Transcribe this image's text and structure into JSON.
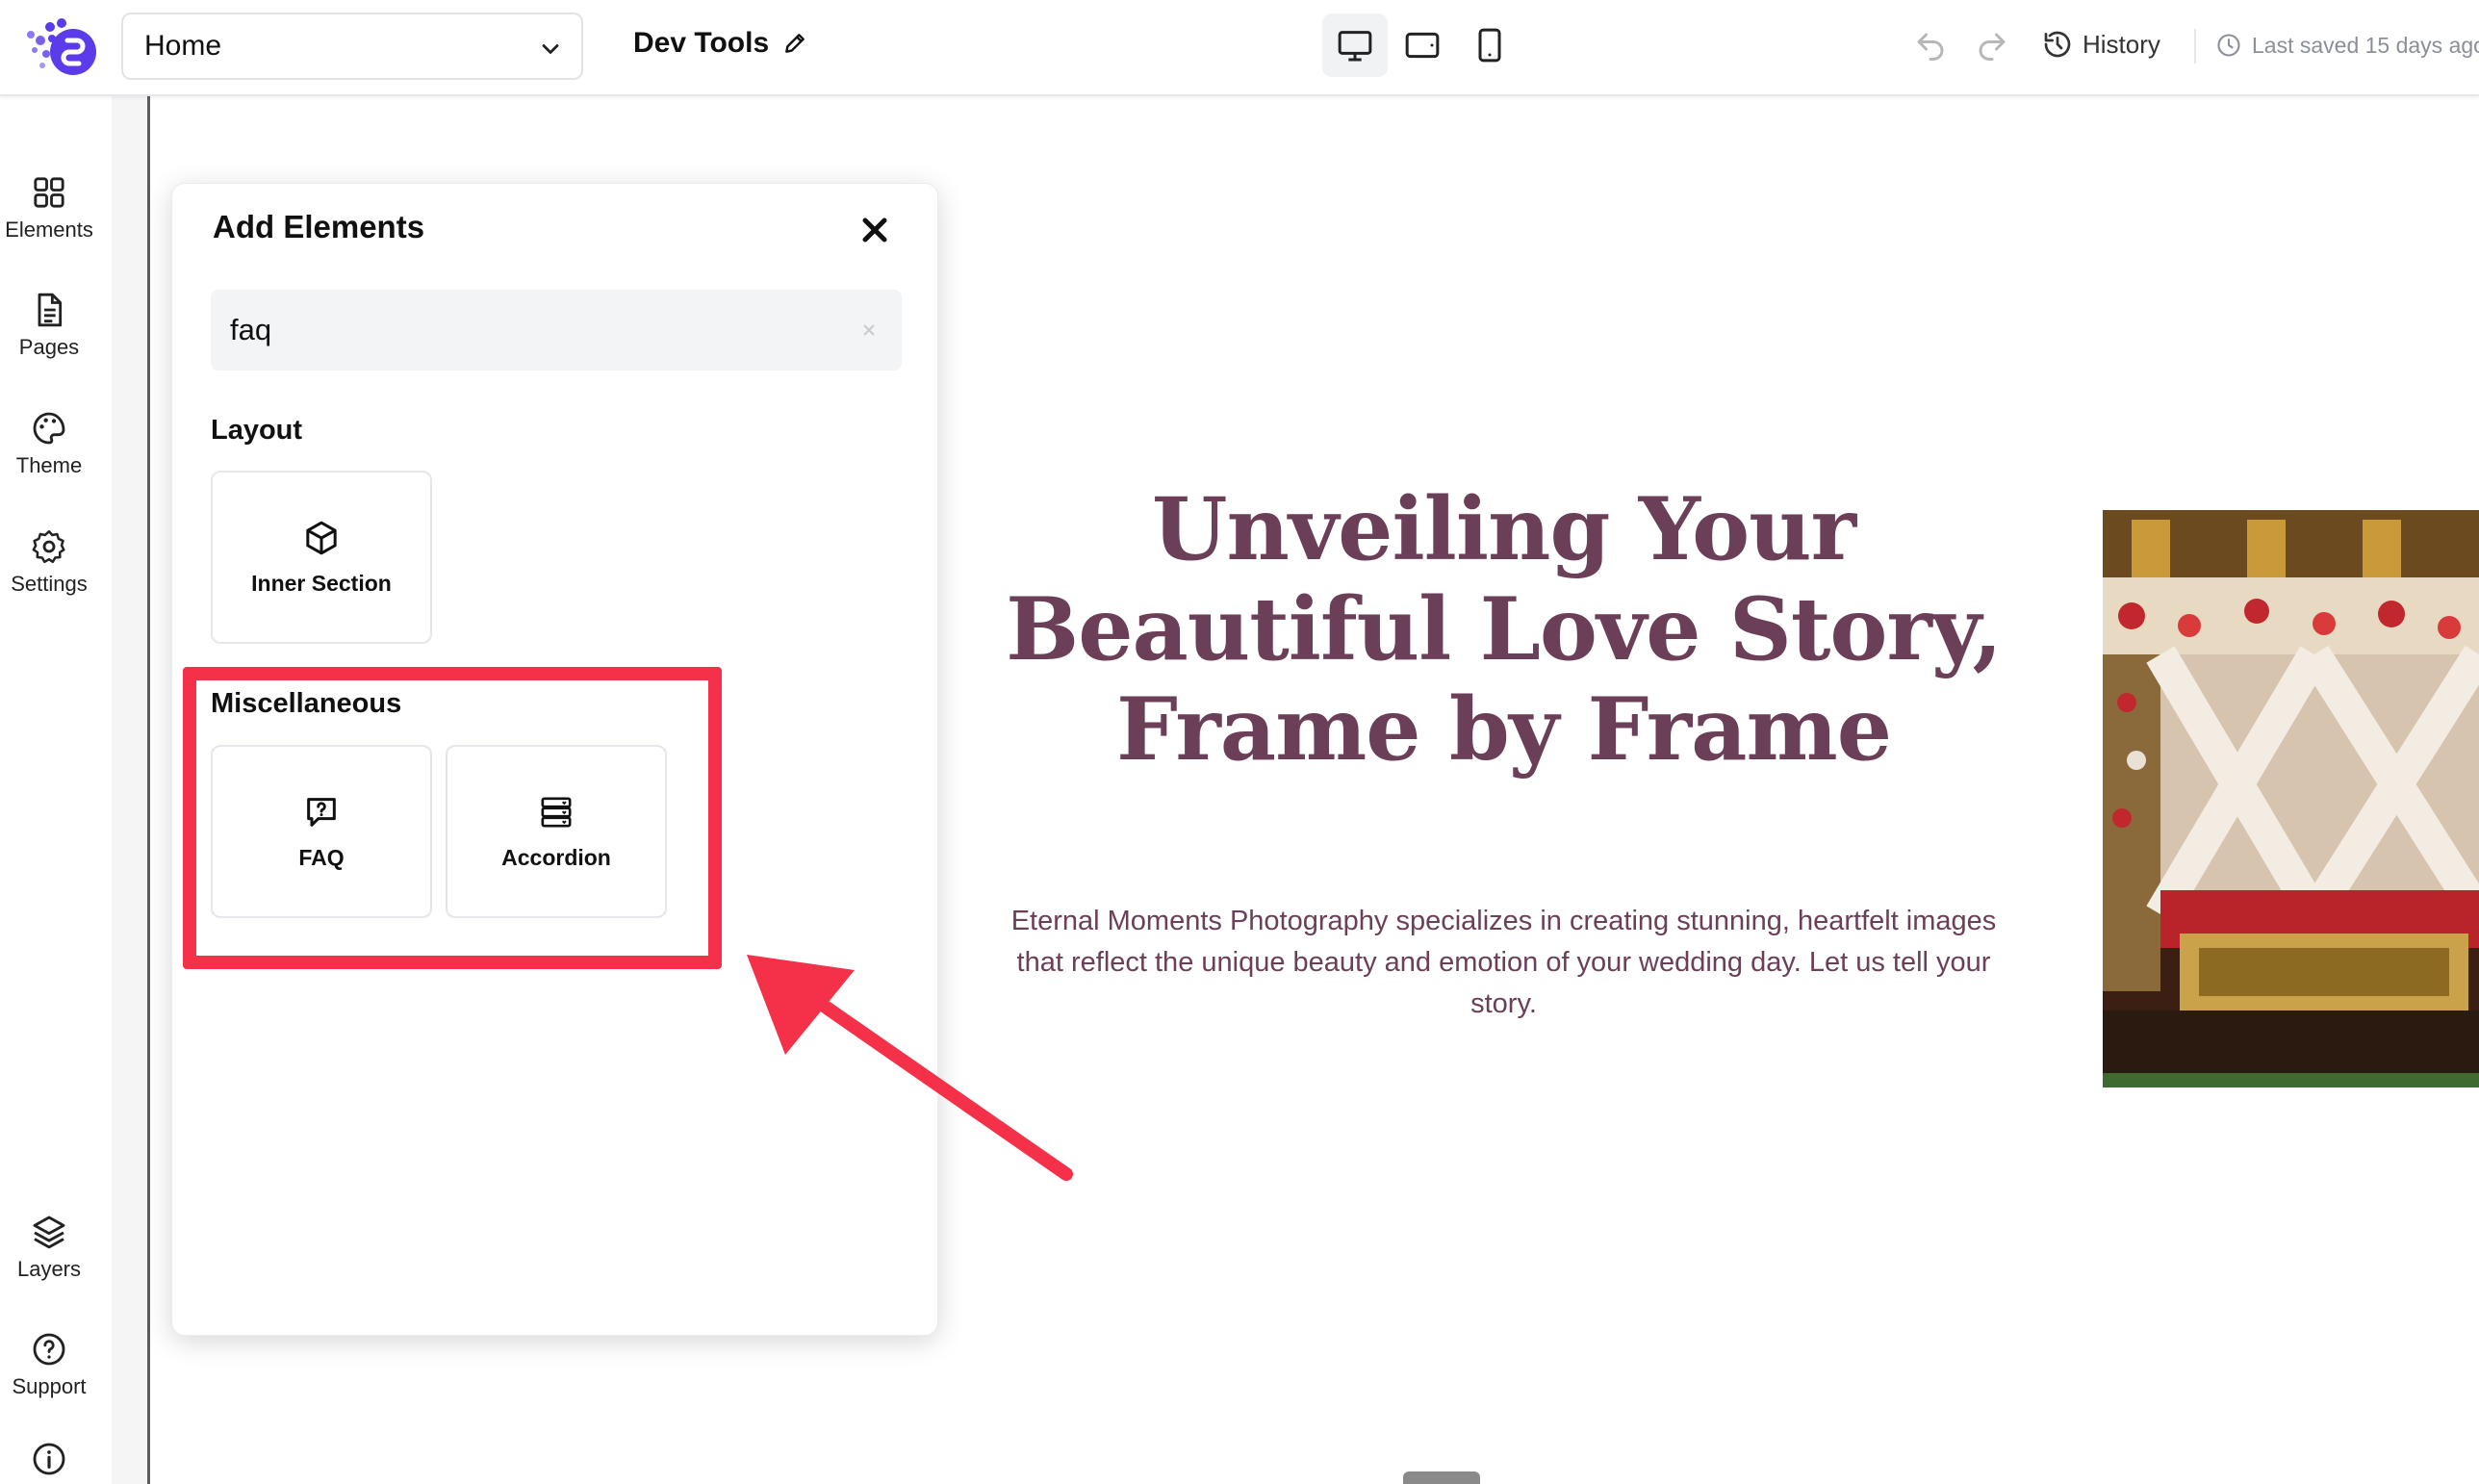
{
  "topbar": {
    "page_select_value": "Home",
    "site_name": "Dev Tools",
    "history_label": "History",
    "last_saved": "Last saved 15 days ago",
    "devices": [
      "desktop-icon",
      "tablet-icon",
      "mobile-icon"
    ],
    "active_device": "desktop"
  },
  "sidebar": {
    "items": [
      {
        "label": "Elements",
        "icon": "grid-icon"
      },
      {
        "label": "Pages",
        "icon": "document-icon"
      },
      {
        "label": "Theme",
        "icon": "palette-icon"
      },
      {
        "label": "Settings",
        "icon": "gear-icon"
      }
    ],
    "bottom_items": [
      {
        "label": "Layers",
        "icon": "layers-icon"
      },
      {
        "label": "Support",
        "icon": "help-icon"
      }
    ]
  },
  "panel": {
    "title": "Add Elements",
    "search_value": "faq",
    "sections": [
      {
        "label": "Layout",
        "tiles": [
          {
            "label": "Inner Section",
            "icon": "cube-icon"
          }
        ]
      },
      {
        "label": "Miscellaneous",
        "tiles": [
          {
            "label": "FAQ",
            "icon": "faq-icon"
          },
          {
            "label": "Accordion",
            "icon": "accordion-icon"
          }
        ]
      }
    ]
  },
  "canvas": {
    "hero_title": "Unveiling Your Beautiful Love Story, Frame by Frame",
    "hero_text": "Eternal Moments Photography specializes in creating stunning, heartfelt images that reflect the unique beauty and emotion of your wedding day. Let us tell your story."
  },
  "colors": {
    "accent": "#6b3f58",
    "highlight": "#f43148",
    "brand": "#5b3bea"
  }
}
